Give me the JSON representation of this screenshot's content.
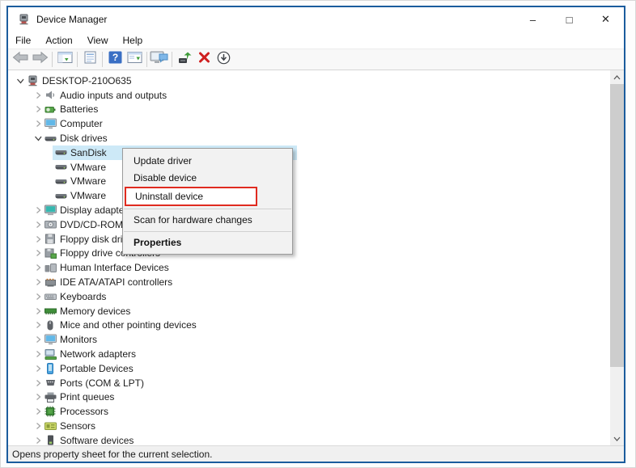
{
  "window": {
    "title": "Device Manager",
    "controls": [
      {
        "name": "minimize",
        "glyph": "–"
      },
      {
        "name": "maximize",
        "glyph": "□"
      },
      {
        "name": "close",
        "glyph": "✕"
      }
    ]
  },
  "menu_bar": {
    "items": [
      "File",
      "Action",
      "View",
      "Help"
    ]
  },
  "toolbar": {
    "items": [
      {
        "icon": "back-arrow"
      },
      {
        "icon": "forward-arrow"
      },
      {
        "sep": true
      },
      {
        "icon": "show-console-tree"
      },
      {
        "sep": true
      },
      {
        "icon": "properties-pane"
      },
      {
        "sep": true
      },
      {
        "icon": "help"
      },
      {
        "icon": "export-list"
      },
      {
        "sep": true
      },
      {
        "icon": "remote-desktop"
      },
      {
        "sep": true
      },
      {
        "icon": "update-driver"
      },
      {
        "icon": "uninstall-device"
      },
      {
        "icon": "scan-hardware"
      }
    ]
  },
  "tree": {
    "items": [
      {
        "label": "DESKTOP-210O635",
        "level": 0,
        "chevron": "expanded",
        "icon": "computer"
      },
      {
        "label": "Audio inputs and outputs",
        "level": 1,
        "chevron": "collapsed",
        "icon": "audio"
      },
      {
        "label": "Batteries",
        "level": 1,
        "chevron": "collapsed",
        "icon": "battery"
      },
      {
        "label": "Computer",
        "level": 1,
        "chevron": "collapsed",
        "icon": "monitor"
      },
      {
        "label": "Disk drives",
        "level": 1,
        "chevron": "expanded",
        "icon": "disk"
      },
      {
        "label": "SanDisk",
        "level": 2,
        "chevron": "none",
        "icon": "disk",
        "selected": true
      },
      {
        "label": "VMware",
        "level": 2,
        "chevron": "none",
        "icon": "disk"
      },
      {
        "label": "VMware",
        "level": 2,
        "chevron": "none",
        "icon": "disk"
      },
      {
        "label": "VMware",
        "level": 2,
        "chevron": "none",
        "icon": "disk"
      },
      {
        "label": "Display adapters",
        "level": 1,
        "chevron": "collapsed",
        "icon": "display"
      },
      {
        "label": "DVD/CD-ROM drives",
        "level": 1,
        "chevron": "collapsed",
        "icon": "dvd"
      },
      {
        "label": "Floppy disk drives",
        "level": 1,
        "chevron": "collapsed",
        "icon": "floppy"
      },
      {
        "label": "Floppy drive controllers",
        "level": 1,
        "chevron": "collapsed",
        "icon": "floppy-controller"
      },
      {
        "label": "Human Interface Devices",
        "level": 1,
        "chevron": "collapsed",
        "icon": "hid"
      },
      {
        "label": "IDE ATA/ATAPI controllers",
        "level": 1,
        "chevron": "collapsed",
        "icon": "ide"
      },
      {
        "label": "Keyboards",
        "level": 1,
        "chevron": "collapsed",
        "icon": "keyboard"
      },
      {
        "label": "Memory devices",
        "level": 1,
        "chevron": "collapsed",
        "icon": "memory"
      },
      {
        "label": "Mice and other pointing devices",
        "level": 1,
        "chevron": "collapsed",
        "icon": "mouse"
      },
      {
        "label": "Monitors",
        "level": 1,
        "chevron": "collapsed",
        "icon": "monitor"
      },
      {
        "label": "Network adapters",
        "level": 1,
        "chevron": "collapsed",
        "icon": "network"
      },
      {
        "label": "Portable Devices",
        "level": 1,
        "chevron": "collapsed",
        "icon": "portable"
      },
      {
        "label": "Ports (COM & LPT)",
        "level": 1,
        "chevron": "collapsed",
        "icon": "ports"
      },
      {
        "label": "Print queues",
        "level": 1,
        "chevron": "collapsed",
        "icon": "printer"
      },
      {
        "label": "Processors",
        "level": 1,
        "chevron": "collapsed",
        "icon": "processor"
      },
      {
        "label": "Sensors",
        "level": 1,
        "chevron": "collapsed",
        "icon": "sensors"
      },
      {
        "label": "Software devices",
        "level": 1,
        "chevron": "collapsed",
        "icon": "software"
      }
    ]
  },
  "context_menu": {
    "items": [
      {
        "label": "Update driver"
      },
      {
        "label": "Disable device"
      },
      {
        "label": "Uninstall device",
        "highlighted": true
      },
      {
        "separator": true
      },
      {
        "label": "Scan for hardware changes"
      },
      {
        "separator": true
      },
      {
        "label": "Properties",
        "bold": true
      }
    ]
  },
  "status_bar": {
    "text": "Opens property sheet for the current selection."
  },
  "colors": {
    "window_border": "#1b5c9d",
    "selection_highlight": "#cde9f7",
    "callout_red": "#e02b20",
    "menu_bg": "#f2f2f2",
    "status_bg": "#f0f0f0"
  }
}
